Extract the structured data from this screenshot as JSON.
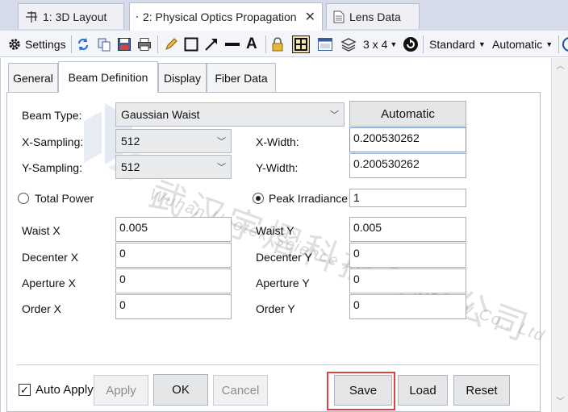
{
  "doc_tabs": [
    {
      "label": "1: 3D Layout",
      "icon": "3d-layout-icon"
    },
    {
      "label": "2: Physical Optics Propagation",
      "icon": "pop-beam-icon",
      "close": "✕"
    },
    {
      "label": "Lens Data",
      "icon": "document-icon"
    }
  ],
  "toolbar": {
    "settings_label": "Settings",
    "grid_label": "3 x 4",
    "standard_label": "Standard",
    "automatic_label": "Automatic"
  },
  "subtabs": [
    "General",
    "Beam Definition",
    "Display",
    "Fiber Data"
  ],
  "form": {
    "beam_type_label": "Beam Type:",
    "beam_type_value": "Gaussian Waist",
    "automatic_button": "Automatic",
    "x_sampling_label": "X-Sampling:",
    "x_sampling_value": "512",
    "y_sampling_label": "Y-Sampling:",
    "y_sampling_value": "512",
    "x_width_label": "X-Width:",
    "x_width_value": "0.200530262",
    "y_width_label": "Y-Width:",
    "y_width_value": "0.200530262",
    "total_power_label": "Total Power",
    "peak_irradiance_label": "Peak Irradiance",
    "peak_irradiance_value": "1",
    "waist_x_label": "Waist X",
    "waist_x_value": "0.005",
    "waist_y_label": "Waist Y",
    "waist_y_value": "0.005",
    "decenter_x_label": "Decenter X",
    "decenter_x_value": "0",
    "decenter_y_label": "Decenter Y",
    "decenter_y_value": "0",
    "aperture_x_label": "Aperture X",
    "aperture_x_value": "0",
    "aperture_y_label": "Aperture Y",
    "aperture_y_value": "0",
    "order_x_label": "Order X",
    "order_x_value": "0",
    "order_y_label": "Order Y",
    "order_y_value": "0"
  },
  "footer": {
    "auto_apply_label": "Auto Apply",
    "apply": "Apply",
    "ok": "OK",
    "cancel": "Cancel",
    "save": "Save",
    "load": "Load",
    "reset": "Reset"
  },
  "watermark": {
    "cn": "武汉宇熠科技有限公司",
    "en": "Wuhan Ueotek Science And Technology Co., Ltd"
  },
  "colors": {
    "highlight": "#e04040",
    "accent": "#1a4f9e"
  }
}
